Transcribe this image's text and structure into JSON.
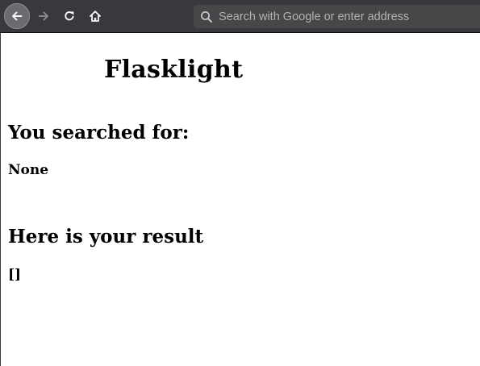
{
  "browser": {
    "urlbar": {
      "placeholder": "Search with Google or enter address",
      "value": ""
    },
    "colors": {
      "toolbar": "#38383d",
      "urlbar": "#474749",
      "icon": "#f9f9fa",
      "icon_disabled": "#8f8f9d"
    },
    "icons": [
      "back-arrow-icon",
      "forward-arrow-icon",
      "reload-icon",
      "home-icon",
      "search-icon"
    ]
  },
  "page": {
    "title": "Flasklight",
    "searched_heading": "You searched for:",
    "searched_value": "None",
    "result_heading": "Here is your result",
    "result_value": "[]"
  }
}
